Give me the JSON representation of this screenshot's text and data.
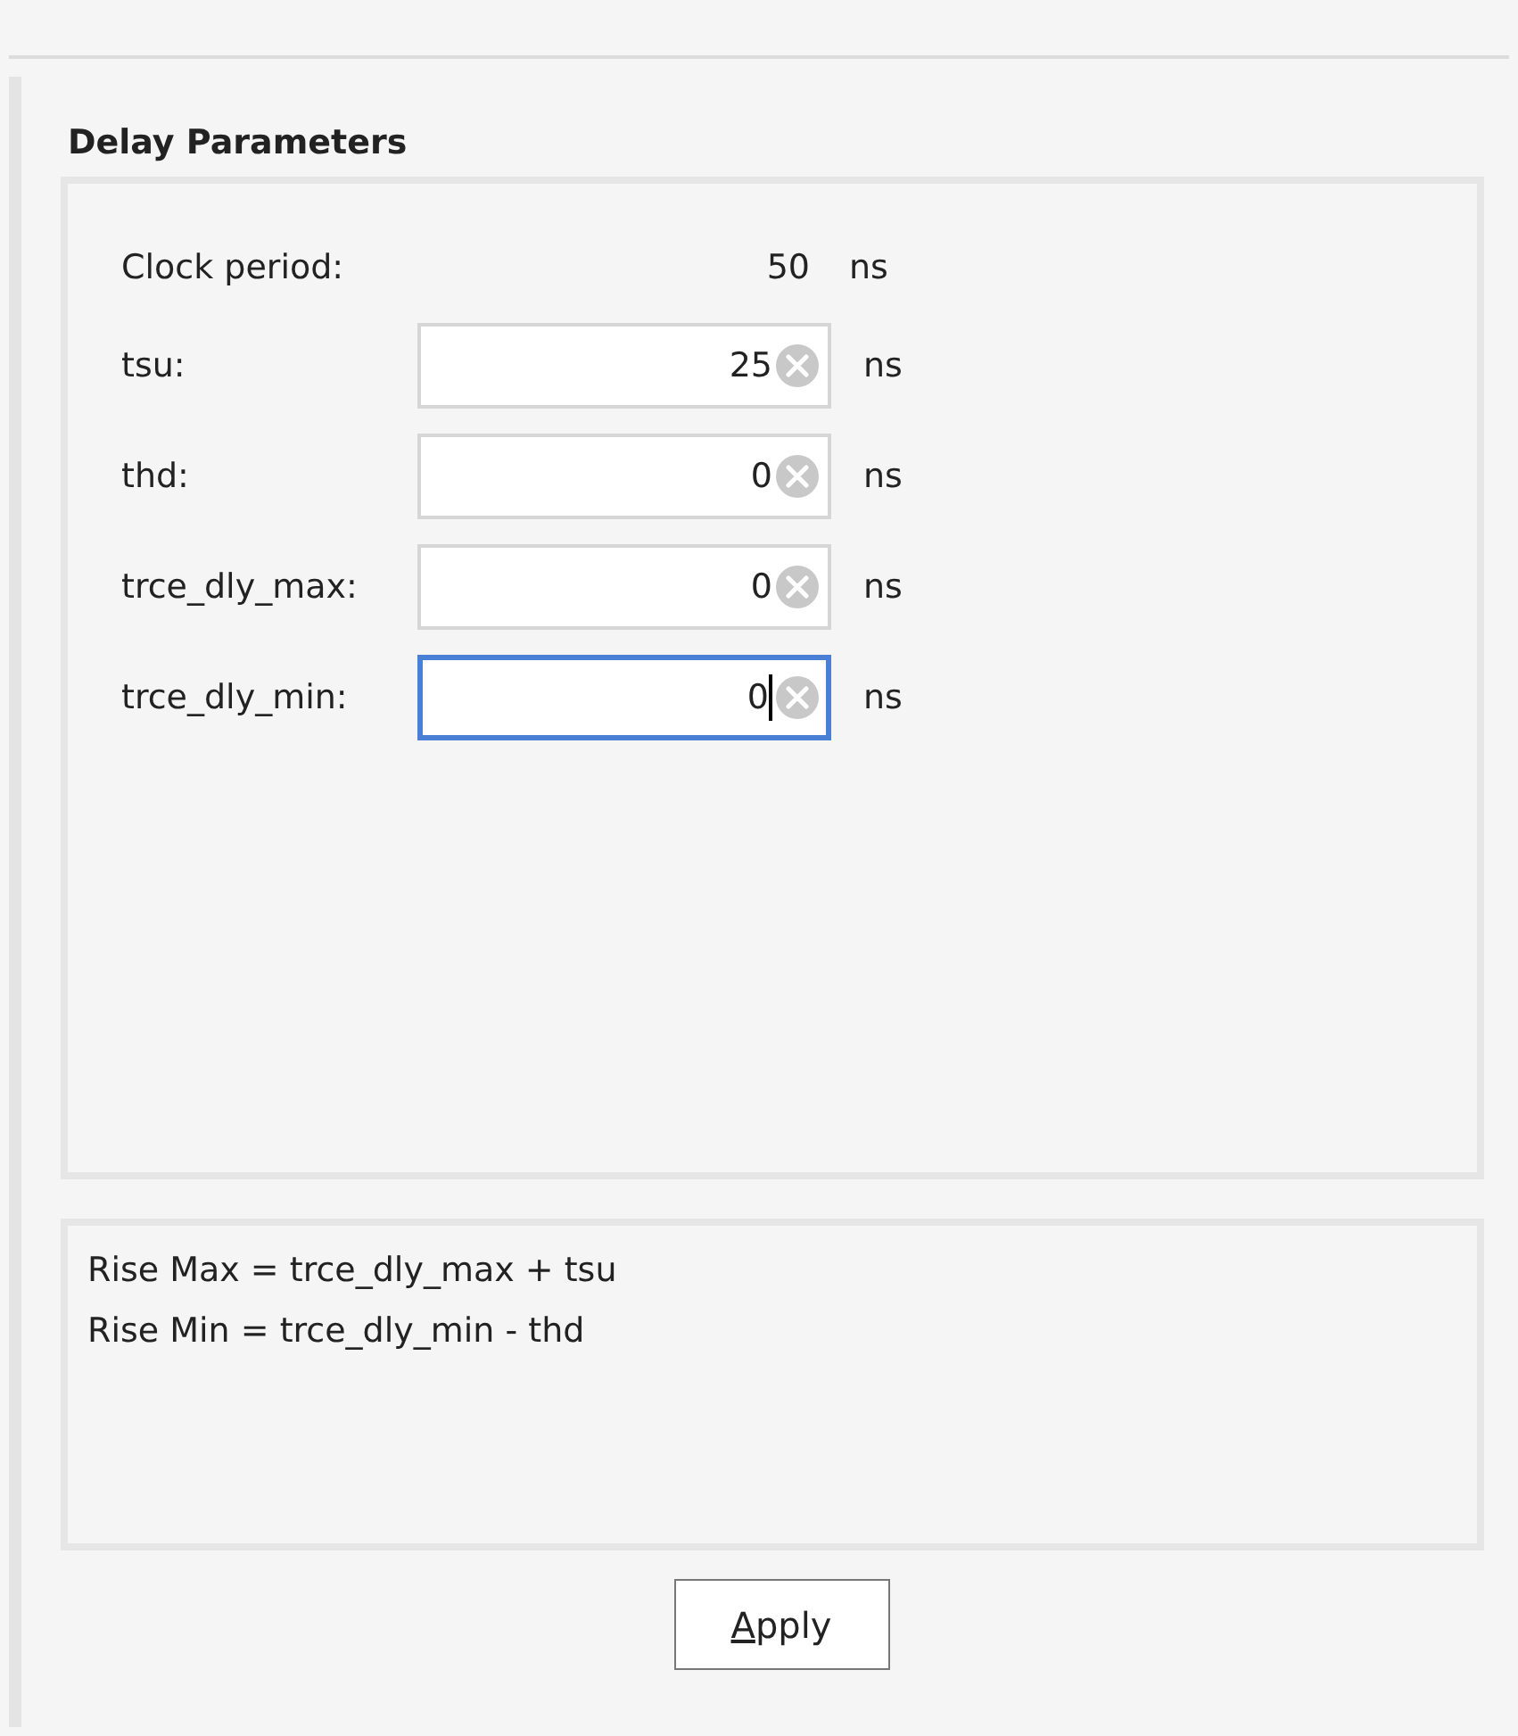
{
  "section": {
    "title": "Delay Parameters"
  },
  "clock_period": {
    "label": "Clock period:",
    "value": "50",
    "unit": "ns"
  },
  "fields": [
    {
      "label": "tsu:",
      "value": "25",
      "unit": "ns",
      "focused": false
    },
    {
      "label": "thd:",
      "value": "0",
      "unit": "ns",
      "focused": false
    },
    {
      "label": "trce_dly_max:",
      "value": "0",
      "unit": "ns",
      "focused": false
    },
    {
      "label": "trce_dly_min:",
      "value": "0",
      "unit": "ns",
      "focused": true
    }
  ],
  "formulas": [
    "Rise Max = trce_dly_max + tsu",
    "Rise Min = trce_dly_min - thd"
  ],
  "apply_button": {
    "label": "Apply",
    "mnemonic_underlined": true
  }
}
